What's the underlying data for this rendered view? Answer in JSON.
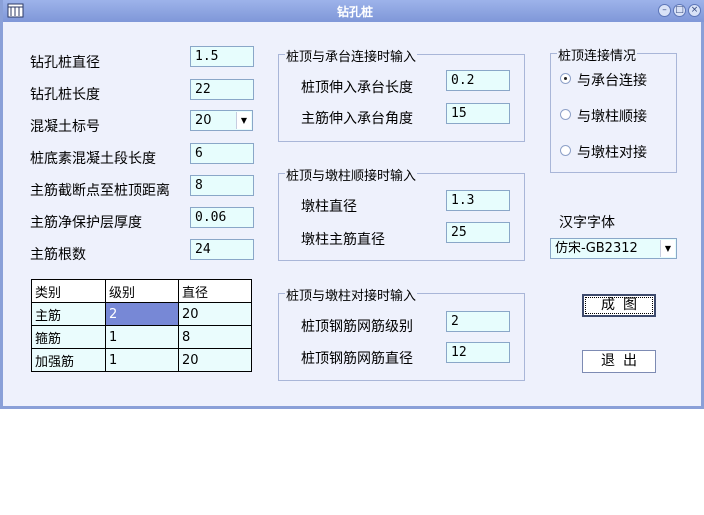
{
  "window": {
    "title": "钻孔桩",
    "min_icon": "minimize-icon",
    "max_icon": "maximize-icon",
    "close_icon": "close-icon"
  },
  "left_fields": [
    {
      "label": "钻孔桩直径",
      "value": "1.5"
    },
    {
      "label": "钻孔桩长度",
      "value": "22"
    },
    {
      "label": "混凝土标号",
      "value": "20"
    },
    {
      "label": "桩底素混凝土段长度",
      "value": "6"
    },
    {
      "label": "主筋截断点至桩顶距离",
      "value": "8"
    },
    {
      "label": "主筋净保护层厚度",
      "value": "0.06"
    },
    {
      "label": "主筋根数",
      "value": "24"
    }
  ],
  "grid": {
    "headers": [
      "类别",
      "级别",
      "直径"
    ],
    "rows": [
      [
        "主筋",
        "2",
        "20"
      ],
      [
        "箍筋",
        "1",
        "8"
      ],
      [
        "加强筋",
        "1",
        "20"
      ]
    ]
  },
  "group_cap": {
    "title": "桩顶与承台连接时输入",
    "fields": [
      {
        "label": "桩顶伸入承台长度",
        "value": "0.2"
      },
      {
        "label": "主筋伸入承台角度",
        "value": "15"
      }
    ]
  },
  "group_pier_seq": {
    "title": "桩顶与墩柱顺接时输入",
    "fields": [
      {
        "label": "墩柱直径",
        "value": "1.3"
      },
      {
        "label": "墩柱主筋直径",
        "value": "25"
      }
    ]
  },
  "group_pier_butt": {
    "title": "桩顶与墩柱对接时输入",
    "fields": [
      {
        "label": "桩顶钢筋网筋级别",
        "value": "2"
      },
      {
        "label": "桩顶钢筋网筋直径",
        "value": "12"
      }
    ]
  },
  "connection": {
    "title": "桩顶连接情况",
    "options": [
      "与承台连接",
      "与墩柱顺接",
      "与墩柱对接"
    ],
    "selected_index": 0
  },
  "font": {
    "label": "汉字字体",
    "value": "仿宋-GB2312"
  },
  "buttons": {
    "draw": "成图",
    "exit": "退出"
  }
}
